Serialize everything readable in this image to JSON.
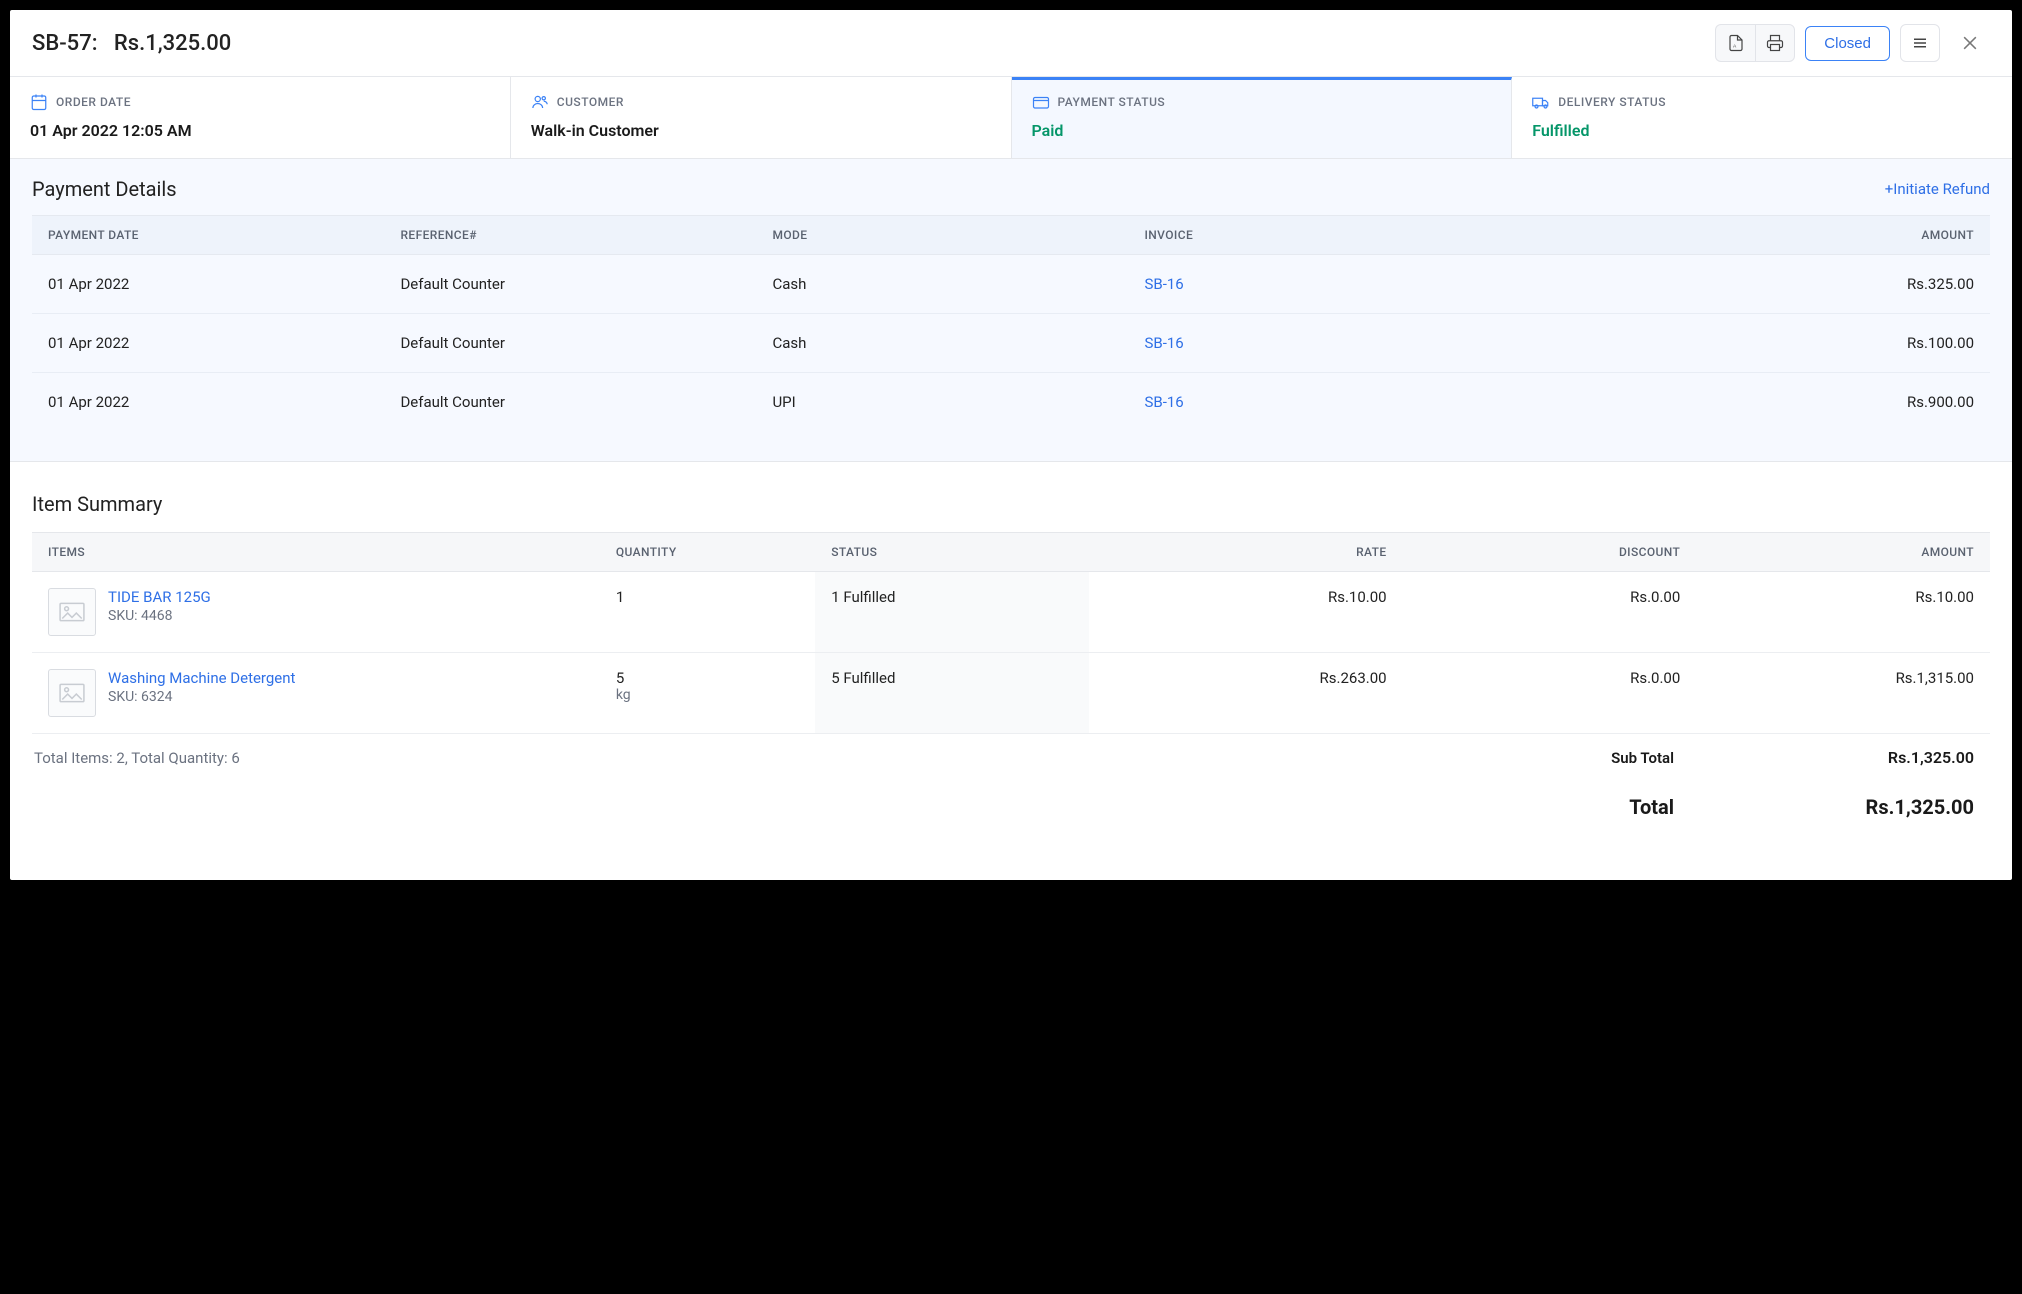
{
  "header": {
    "order_id": "SB-57:",
    "order_total": "Rs.1,325.00",
    "closed_label": "Closed"
  },
  "info": {
    "order_date_label": "ORDER DATE",
    "order_date_value": "01 Apr 2022 12:05 AM",
    "customer_label": "CUSTOMER",
    "customer_value": "Walk-in Customer",
    "payment_status_label": "PAYMENT STATUS",
    "payment_status_value": "Paid",
    "delivery_status_label": "DELIVERY STATUS",
    "delivery_status_value": "Fulfilled"
  },
  "payment": {
    "section_title": "Payment Details",
    "refund_link": "+Initiate Refund",
    "headers": {
      "date": "PAYMENT DATE",
      "reference": "REFERENCE#",
      "mode": "MODE",
      "invoice": "INVOICE",
      "amount": "AMOUNT"
    },
    "rows": [
      {
        "date": "01 Apr 2022",
        "reference": "Default Counter",
        "mode": "Cash",
        "invoice": "SB-16",
        "amount": "Rs.325.00"
      },
      {
        "date": "01 Apr 2022",
        "reference": "Default Counter",
        "mode": "Cash",
        "invoice": "SB-16",
        "amount": "Rs.100.00"
      },
      {
        "date": "01 Apr 2022",
        "reference": "Default Counter",
        "mode": "UPI",
        "invoice": "SB-16",
        "amount": "Rs.900.00"
      }
    ]
  },
  "items": {
    "section_title": "Item Summary",
    "headers": {
      "items": "ITEMS",
      "quantity": "QUANTITY",
      "status": "STATUS",
      "rate": "RATE",
      "discount": "DISCOUNT",
      "amount": "AMOUNT"
    },
    "rows": [
      {
        "name": "TIDE BAR 125G",
        "sku": "SKU: 4468",
        "qty": "1",
        "unit": "",
        "status": "1 Fulfilled",
        "rate": "Rs.10.00",
        "discount": "Rs.0.00",
        "amount": "Rs.10.00"
      },
      {
        "name": "Washing Machine Detergent",
        "sku": "SKU: 6324",
        "qty": "5",
        "unit": "kg",
        "status": "5 Fulfilled",
        "rate": "Rs.263.00",
        "discount": "Rs.0.00",
        "amount": "Rs.1,315.00"
      }
    ],
    "totals_left": "Total Items: 2, Total Quantity: 6",
    "subtotal_label": "Sub Total",
    "subtotal_value": "Rs.1,325.00",
    "total_label": "Total",
    "total_value": "Rs.1,325.00"
  }
}
